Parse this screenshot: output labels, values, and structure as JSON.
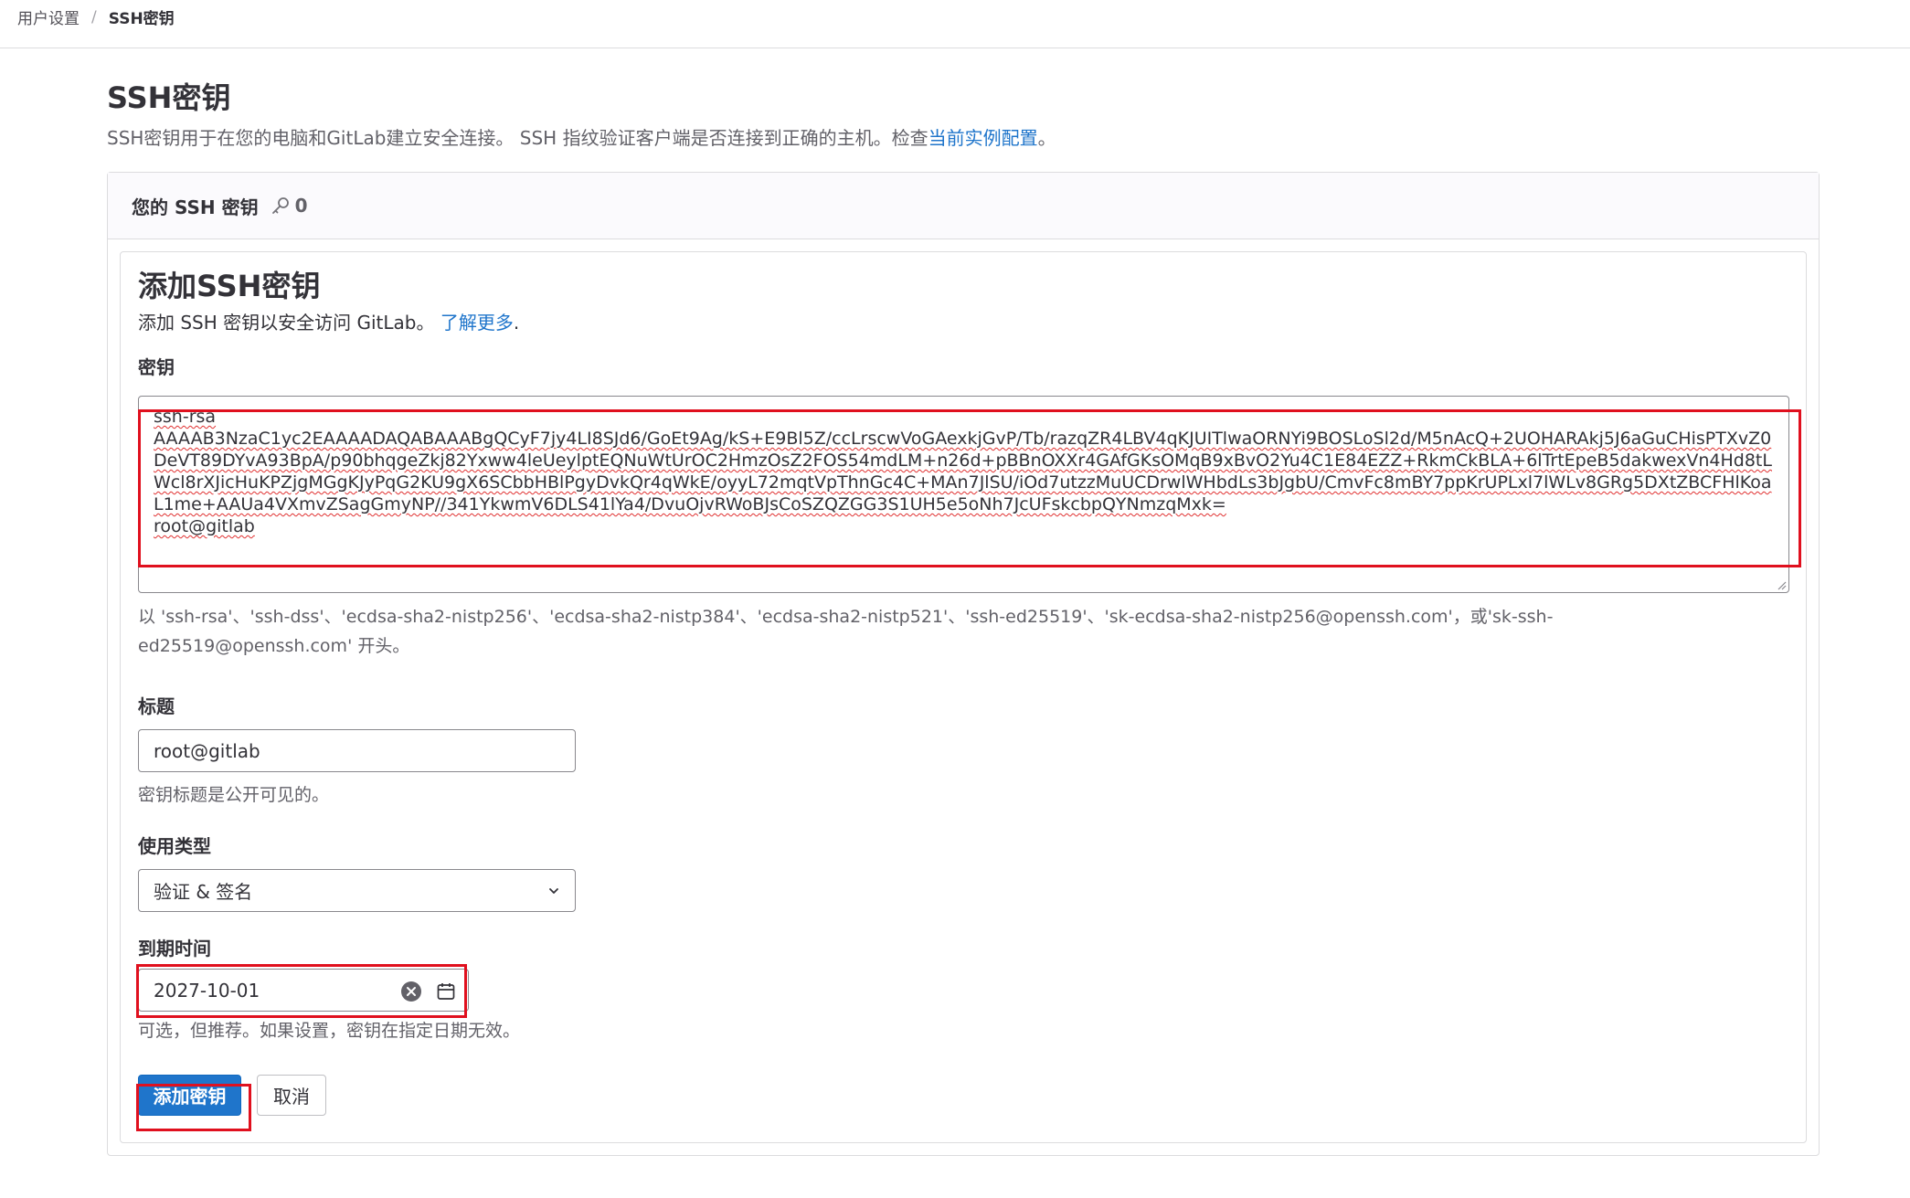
{
  "breadcrumb": {
    "parent": "用户设置",
    "separator": "/",
    "current": "SSH密钥"
  },
  "page": {
    "title": "SSH密钥",
    "description_prefix": "SSH密钥用于在您的电脑和GitLab建立安全连接。 SSH 指纹验证客户端是否连接到正确的主机。检查",
    "description_link": "当前实例配置",
    "description_suffix": "。"
  },
  "keys_card": {
    "header_title": "您的 SSH 密钥",
    "key_icon": "key-icon",
    "key_count": "0"
  },
  "form": {
    "title": "添加SSH密钥",
    "description_prefix": "添加 SSH 密钥以安全访问 GitLab。 ",
    "description_link": "了解更多",
    "description_suffix": ".",
    "key_label": "密钥",
    "key_value": {
      "line1": "ssh-rsa",
      "body": "AAAAB3NzaC1yc2EAAAADAQABAAABgQCyF7jy4LI8SJd6/GoEt9Ag/kS+E9Bl5Z/ccLrscwVoGAexkjGvP/Tb/razqZR4LBV4qKJUITlwaORNYi9BOSLoSl2d/M5nAcQ+2UOHARAkj5J6aGuCHisPTXvZ0DeVT89DYvA93BpA/p90bhqgeZkj82Yxww4leUeylptEQNuWtUrOC2HmzOsZ2FOS54mdLM+n26d+pBBnOXXr4GAfGKsOMqB9xBvO2Yu4C1E84EZZ+RkmCkBLA+6lTrtEpeB5dakwexVn4Hd8tLWcl8rXJicHuKPZjgMGgKJyPqG2KU9gX6SCbbHBlPgyDvkQr4qWkE/oyyL72mqtVpThnGc4C+MAn7JlSU/iOd7utzzMuUCDrwlWHbdLs3bJgbU/CmvFc8mBY7ppKrUPLxl7lWLv8GRg5DXtZBCFHlKoaL1me+AAUa4VXmvZSagGmyNP//341YkwmV6DLS41lYa4/DvuOjvRWoBJsCoSZQZGG3S1UH5e5oNh7JcUFskcbpQYNmzqMxk=",
      "line_last": "root@gitlab"
    },
    "key_help": "以 'ssh-rsa'、'ssh-dss'、'ecdsa-sha2-nistp256'、'ecdsa-sha2-nistp384'、'ecdsa-sha2-nistp521'、'ssh-ed25519'、'sk-ecdsa-sha2-nistp256@openssh.com'，或'sk-ssh-ed25519@openssh.com' 开头。",
    "title_label": "标题",
    "title_value": "root@gitlab",
    "title_help": "密钥标题是公开可见的。",
    "usage_label": "使用类型",
    "usage_value": "验证 & 签名",
    "expires_label": "到期时间",
    "expires_value": "2027-10-01",
    "expires_help": "可选，但推荐。如果设置，密钥在指定日期无效。",
    "submit_label": "添加密钥",
    "cancel_label": "取消"
  },
  "colors": {
    "primary": "#1f75cb",
    "highlight": "#e0101e",
    "link": "#1f75cb"
  }
}
